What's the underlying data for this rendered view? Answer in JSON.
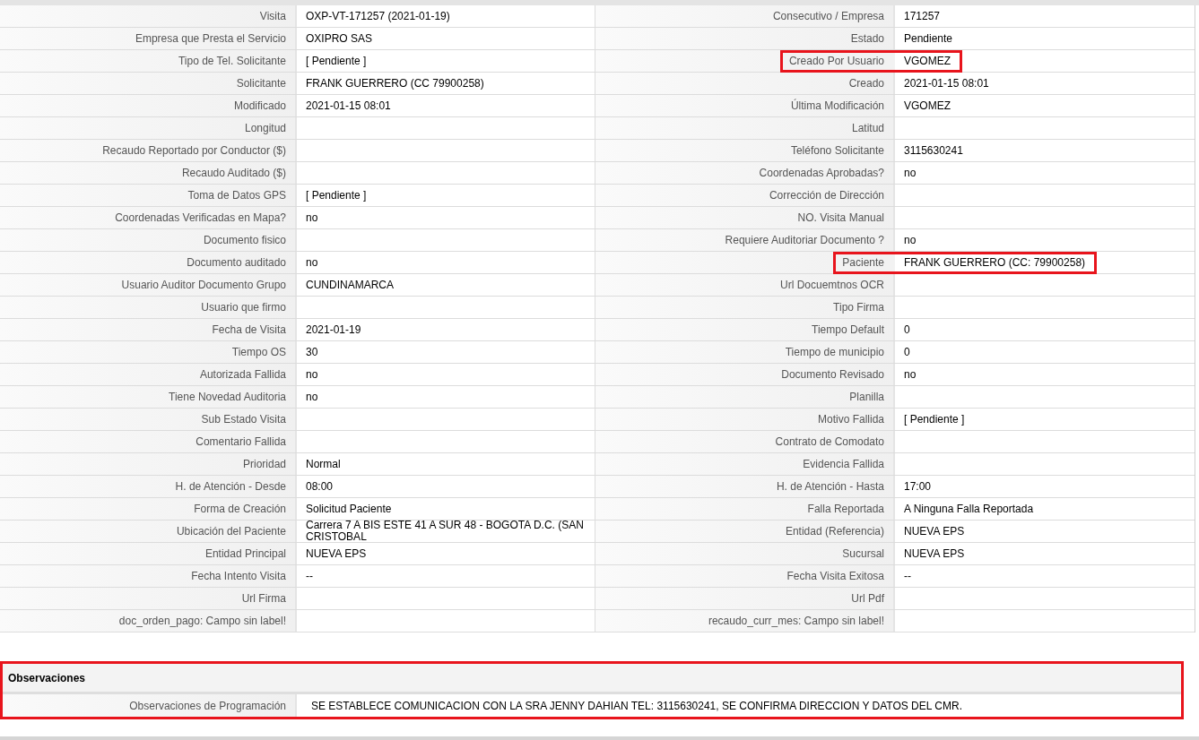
{
  "fields": [
    {
      "left": {
        "label": "Visita",
        "value": "OXP-VT-171257 (2021-01-19)",
        "highlighted": false
      },
      "right": {
        "label": "Consecutivo / Empresa",
        "value": "171257",
        "highlighted": false
      }
    },
    {
      "left": {
        "label": "Empresa que Presta el Servicio",
        "value": "OXIPRO SAS",
        "highlighted": false
      },
      "right": {
        "label": "Estado",
        "value": "Pendiente",
        "highlighted": false
      }
    },
    {
      "left": {
        "label": "Tipo de Tel. Solicitante",
        "value": "[ Pendiente ]",
        "highlighted": false
      },
      "right": {
        "label": "Creado Por Usuario",
        "value": "VGOMEZ",
        "highlighted": true
      }
    },
    {
      "left": {
        "label": "Solicitante",
        "value": "FRANK GUERRERO (CC 79900258)",
        "highlighted": false
      },
      "right": {
        "label": "Creado",
        "value": "2021-01-15 08:01",
        "highlighted": false
      }
    },
    {
      "left": {
        "label": "Modificado",
        "value": "2021-01-15 08:01",
        "highlighted": false
      },
      "right": {
        "label": "Última Modificación",
        "value": "VGOMEZ",
        "highlighted": false
      }
    },
    {
      "left": {
        "label": "Longitud",
        "highlighted": false
      },
      "right": {
        "label": "Latitud",
        "highlighted": false
      }
    },
    {
      "left": {
        "label": "Recaudo Reportado por Conductor ($)",
        "highlighted": false
      },
      "right": {
        "label": "Teléfono Solicitante",
        "value": "3115630241",
        "highlighted": false
      }
    },
    {
      "left": {
        "label": "Recaudo Auditado ($)",
        "highlighted": false
      },
      "right": {
        "label": "Coordenadas Aprobadas?",
        "value": "no",
        "highlighted": false
      }
    },
    {
      "left": {
        "label": "Toma de Datos GPS",
        "value": "[ Pendiente ]",
        "highlighted": false
      },
      "right": {
        "label": "Corrección de Dirección",
        "highlighted": false
      }
    },
    {
      "left": {
        "label": "Coordenadas Verificadas en Mapa?",
        "value": "no",
        "highlighted": false
      },
      "right": {
        "label": "NO. Visita Manual",
        "highlighted": false
      }
    },
    {
      "left": {
        "label": "Documento fisico",
        "highlighted": false
      },
      "right": {
        "label": "Requiere Auditoriar Documento ?",
        "value": "no",
        "highlighted": false
      }
    },
    {
      "left": {
        "label": "Documento auditado",
        "value": "no",
        "highlighted": false
      },
      "right": {
        "label": "Paciente",
        "value": "FRANK GUERRERO (CC: 79900258)",
        "highlighted": true
      }
    },
    {
      "left": {
        "label": "Usuario Auditor Documento Grupo",
        "value": "CUNDINAMARCA",
        "highlighted": false
      },
      "right": {
        "label": "Url Docuemtnos OCR",
        "highlighted": false
      }
    },
    {
      "left": {
        "label": "Usuario que firmo",
        "highlighted": false
      },
      "right": {
        "label": "Tipo Firma",
        "highlighted": false
      }
    },
    {
      "left": {
        "label": "Fecha de Visita",
        "value": "2021-01-19",
        "highlighted": false
      },
      "right": {
        "label": "Tiempo Default",
        "value": "0",
        "highlighted": false
      }
    },
    {
      "left": {
        "label": "Tiempo OS",
        "value": "30",
        "highlighted": false
      },
      "right": {
        "label": "Tiempo de municipio",
        "value": "0",
        "highlighted": false
      }
    },
    {
      "left": {
        "label": "Autorizada Fallida",
        "value": "no",
        "highlighted": false
      },
      "right": {
        "label": "Documento Revisado",
        "value": "no",
        "highlighted": false
      }
    },
    {
      "left": {
        "label": "Tiene Novedad Auditoria",
        "value": "no",
        "highlighted": false
      },
      "right": {
        "label": "Planilla",
        "highlighted": false
      }
    },
    {
      "left": {
        "label": "Sub Estado Visita",
        "highlighted": false
      },
      "right": {
        "label": "Motivo Fallida",
        "value": "[ Pendiente ]",
        "highlighted": false
      }
    },
    {
      "left": {
        "label": "Comentario Fallida",
        "highlighted": false
      },
      "right": {
        "label": "Contrato de Comodato",
        "highlighted": false
      }
    },
    {
      "left": {
        "label": "Prioridad",
        "value": "Normal",
        "highlighted": false
      },
      "right": {
        "label": "Evidencia Fallida",
        "highlighted": false
      }
    },
    {
      "left": {
        "label": "H. de Atención - Desde",
        "value": "08:00",
        "highlighted": false
      },
      "right": {
        "label": "H. de Atención - Hasta",
        "value": "17:00",
        "highlighted": false
      }
    },
    {
      "left": {
        "label": "Forma de Creación",
        "value": "Solicitud Paciente",
        "highlighted": false
      },
      "right": {
        "label": "Falla Reportada",
        "value": "A Ninguna Falla Reportada",
        "highlighted": false
      }
    },
    {
      "left": {
        "label": "Ubicación del Paciente",
        "value": "Carrera 7 A BIS ESTE 41 A SUR 48 - BOGOTA D.C. (SAN CRISTOBAL",
        "highlighted": false
      },
      "right": {
        "label": "Entidad (Referencia)",
        "value": "NUEVA EPS",
        "highlighted": false
      }
    },
    {
      "left": {
        "label": "Entidad Principal",
        "value": "NUEVA EPS",
        "highlighted": false
      },
      "right": {
        "label": "Sucursal",
        "value": "NUEVA EPS",
        "highlighted": false
      }
    },
    {
      "left": {
        "label": "Fecha Intento Visita",
        "value": "--",
        "highlighted": false
      },
      "right": {
        "label": "Fecha Visita Exitosa",
        "value": "--",
        "highlighted": false
      }
    },
    {
      "left": {
        "label": "Url Firma",
        "highlighted": false
      },
      "right": {
        "label": "Url Pdf",
        "highlighted": false
      }
    },
    {
      "left": {
        "label": "doc_orden_pago: Campo sin label!",
        "highlighted": false
      },
      "right": {
        "label": "recaudo_curr_mes: Campo sin label!",
        "highlighted": false
      }
    }
  ],
  "observaciones": {
    "title": "Observaciones",
    "highlighted": true,
    "fields": [
      {
        "label": "Observaciones de Programación",
        "value": "SE ESTABLECE COMUNICACION CON LA SRA JENNY DAHIAN TEL: 3115630241, SE CONFIRMA DIRECCION Y DATOS DEL CMR."
      }
    ]
  }
}
